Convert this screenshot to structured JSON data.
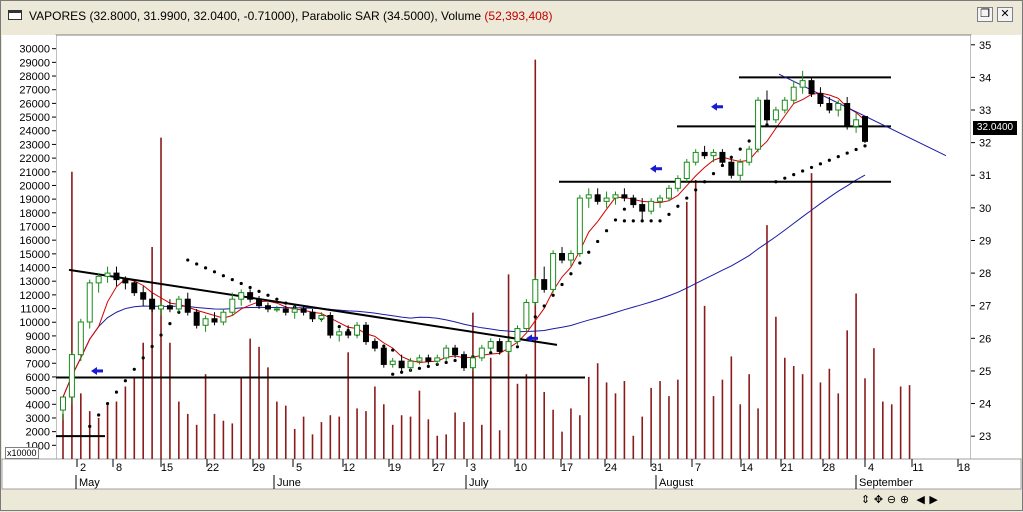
{
  "window": {
    "title_main": "VAPORES (32.8000, 31.9900, 32.0400, -0.71000), Parabolic SAR (34.5000), Volume",
    "title_volume": "(52,393,408)",
    "restore_icon": "restore-icon",
    "close_icon": "close-icon"
  },
  "chart_data": {
    "type": "candlestick",
    "title": "VAPORES",
    "ohlc_summary": {
      "open": 32.8,
      "high": 31.99,
      "low": 32.04,
      "change": -0.71
    },
    "parabolic_sar_last": 34.5,
    "volume_last": "52,393,408",
    "last_price_label": "32.0400",
    "price_axis": {
      "range": [
        22.3,
        35.3
      ],
      "ticks": [
        23,
        24,
        25,
        26,
        27,
        28,
        29,
        30,
        31,
        32,
        33,
        34,
        35
      ]
    },
    "volume_axis": {
      "unit_label": "x10000",
      "range": [
        0,
        31000
      ],
      "ticks": [
        1000,
        2000,
        3000,
        4000,
        5000,
        6000,
        7000,
        8000,
        9000,
        10000,
        11000,
        12000,
        13000,
        14000,
        15000,
        16000,
        17000,
        18000,
        19000,
        20000,
        21000,
        22000,
        23000,
        24000,
        25000,
        26000,
        27000,
        28000,
        29000,
        30000
      ]
    },
    "x_day_labels": [
      "2",
      "8",
      "15",
      "22",
      "29",
      "5",
      "12",
      "19",
      "27",
      "3",
      "10",
      "17",
      "24",
      "31",
      "7",
      "14",
      "21",
      "28",
      "4",
      "11",
      "18"
    ],
    "x_month_labels": [
      "May",
      "June",
      "July",
      "August",
      "September"
    ],
    "candles": [
      {
        "o": 23.8,
        "h": 24.1,
        "l": 23.5,
        "c": 24.2
      },
      {
        "o": 24.2,
        "h": 25.6,
        "l": 24.0,
        "c": 25.5
      },
      {
        "o": 25.5,
        "h": 26.6,
        "l": 25.3,
        "c": 26.5
      },
      {
        "o": 26.5,
        "h": 27.8,
        "l": 26.3,
        "c": 27.7
      },
      {
        "o": 27.7,
        "h": 28.0,
        "l": 27.4,
        "c": 27.9
      },
      {
        "o": 27.9,
        "h": 28.2,
        "l": 27.7,
        "c": 28.0
      },
      {
        "o": 28.0,
        "h": 28.2,
        "l": 27.6,
        "c": 27.8
      },
      {
        "o": 27.8,
        "h": 27.9,
        "l": 27.5,
        "c": 27.7
      },
      {
        "o": 27.7,
        "h": 27.8,
        "l": 27.3,
        "c": 27.4
      },
      {
        "o": 27.4,
        "h": 27.6,
        "l": 27.0,
        "c": 27.2
      },
      {
        "o": 27.2,
        "h": 27.4,
        "l": 26.8,
        "c": 26.9
      },
      {
        "o": 26.9,
        "h": 27.1,
        "l": 26.7,
        "c": 27.0
      },
      {
        "o": 27.0,
        "h": 27.2,
        "l": 26.8,
        "c": 26.9
      },
      {
        "o": 26.9,
        "h": 27.3,
        "l": 26.8,
        "c": 27.2
      },
      {
        "o": 27.2,
        "h": 27.4,
        "l": 26.7,
        "c": 26.8
      },
      {
        "o": 26.8,
        "h": 26.9,
        "l": 26.3,
        "c": 26.4
      },
      {
        "o": 26.4,
        "h": 26.7,
        "l": 26.2,
        "c": 26.6
      },
      {
        "o": 26.6,
        "h": 26.8,
        "l": 26.4,
        "c": 26.5
      },
      {
        "o": 26.5,
        "h": 26.9,
        "l": 26.4,
        "c": 26.8
      },
      {
        "o": 26.8,
        "h": 27.4,
        "l": 26.7,
        "c": 27.2
      },
      {
        "o": 27.2,
        "h": 27.5,
        "l": 27.0,
        "c": 27.4
      },
      {
        "o": 27.4,
        "h": 27.5,
        "l": 27.1,
        "c": 27.2
      },
      {
        "o": 27.2,
        "h": 27.3,
        "l": 26.9,
        "c": 27.0
      },
      {
        "o": 27.0,
        "h": 27.1,
        "l": 26.8,
        "c": 26.9
      },
      {
        "o": 26.9,
        "h": 27.0,
        "l": 26.8,
        "c": 26.9
      },
      {
        "o": 26.9,
        "h": 27.0,
        "l": 26.7,
        "c": 26.8
      },
      {
        "o": 26.8,
        "h": 27.0,
        "l": 26.6,
        "c": 26.9
      },
      {
        "o": 26.9,
        "h": 27.0,
        "l": 26.7,
        "c": 26.8
      },
      {
        "o": 26.8,
        "h": 26.9,
        "l": 26.5,
        "c": 26.6
      },
      {
        "o": 26.6,
        "h": 26.8,
        "l": 26.5,
        "c": 26.7
      },
      {
        "o": 26.7,
        "h": 26.8,
        "l": 26.0,
        "c": 26.1
      },
      {
        "o": 26.1,
        "h": 26.3,
        "l": 25.9,
        "c": 26.2
      },
      {
        "o": 26.2,
        "h": 26.4,
        "l": 26.0,
        "c": 26.1
      },
      {
        "o": 26.1,
        "h": 26.5,
        "l": 26.0,
        "c": 26.4
      },
      {
        "o": 26.4,
        "h": 26.5,
        "l": 25.8,
        "c": 25.9
      },
      {
        "o": 25.9,
        "h": 26.0,
        "l": 25.6,
        "c": 25.7
      },
      {
        "o": 25.7,
        "h": 25.8,
        "l": 25.1,
        "c": 25.2
      },
      {
        "o": 25.2,
        "h": 25.4,
        "l": 25.1,
        "c": 25.3
      },
      {
        "o": 25.3,
        "h": 25.5,
        "l": 25.0,
        "c": 25.1
      },
      {
        "o": 25.1,
        "h": 25.4,
        "l": 25.0,
        "c": 25.3
      },
      {
        "o": 25.3,
        "h": 25.5,
        "l": 25.2,
        "c": 25.4
      },
      {
        "o": 25.4,
        "h": 25.5,
        "l": 25.2,
        "c": 25.3
      },
      {
        "o": 25.3,
        "h": 25.5,
        "l": 25.2,
        "c": 25.4
      },
      {
        "o": 25.4,
        "h": 25.8,
        "l": 25.3,
        "c": 25.7
      },
      {
        "o": 25.7,
        "h": 25.8,
        "l": 25.4,
        "c": 25.5
      },
      {
        "o": 25.5,
        "h": 25.6,
        "l": 25.0,
        "c": 25.1
      },
      {
        "o": 25.1,
        "h": 25.5,
        "l": 25.0,
        "c": 25.4
      },
      {
        "o": 25.4,
        "h": 25.8,
        "l": 25.3,
        "c": 25.7
      },
      {
        "o": 25.7,
        "h": 26.0,
        "l": 25.6,
        "c": 25.9
      },
      {
        "o": 25.9,
        "h": 26.0,
        "l": 25.5,
        "c": 25.6
      },
      {
        "o": 25.6,
        "h": 26.0,
        "l": 25.5,
        "c": 25.9
      },
      {
        "o": 25.9,
        "h": 26.4,
        "l": 25.8,
        "c": 26.3
      },
      {
        "o": 26.3,
        "h": 27.2,
        "l": 26.2,
        "c": 27.1
      },
      {
        "o": 27.1,
        "h": 27.9,
        "l": 27.0,
        "c": 27.8
      },
      {
        "o": 27.8,
        "h": 28.2,
        "l": 27.4,
        "c": 27.5
      },
      {
        "o": 27.5,
        "h": 28.7,
        "l": 27.4,
        "c": 28.6
      },
      {
        "o": 28.6,
        "h": 28.8,
        "l": 28.3,
        "c": 28.4
      },
      {
        "o": 28.4,
        "h": 28.7,
        "l": 28.2,
        "c": 28.6
      },
      {
        "o": 28.6,
        "h": 30.4,
        "l": 28.5,
        "c": 30.3
      },
      {
        "o": 30.3,
        "h": 30.6,
        "l": 30.0,
        "c": 30.4
      },
      {
        "o": 30.4,
        "h": 30.6,
        "l": 30.1,
        "c": 30.2
      },
      {
        "o": 30.2,
        "h": 30.5,
        "l": 30.0,
        "c": 30.3
      },
      {
        "o": 30.3,
        "h": 30.5,
        "l": 30.1,
        "c": 30.4
      },
      {
        "o": 30.4,
        "h": 30.6,
        "l": 30.2,
        "c": 30.3
      },
      {
        "o": 30.3,
        "h": 30.4,
        "l": 30.0,
        "c": 30.1
      },
      {
        "o": 30.1,
        "h": 30.3,
        "l": 29.6,
        "c": 29.9
      },
      {
        "o": 29.9,
        "h": 30.3,
        "l": 29.8,
        "c": 30.2
      },
      {
        "o": 30.2,
        "h": 30.4,
        "l": 30.0,
        "c": 30.3
      },
      {
        "o": 30.3,
        "h": 30.7,
        "l": 30.2,
        "c": 30.6
      },
      {
        "o": 30.6,
        "h": 31.0,
        "l": 30.5,
        "c": 30.9
      },
      {
        "o": 30.9,
        "h": 31.5,
        "l": 30.8,
        "c": 31.4
      },
      {
        "o": 31.4,
        "h": 31.8,
        "l": 31.3,
        "c": 31.7
      },
      {
        "o": 31.7,
        "h": 31.9,
        "l": 31.5,
        "c": 31.6
      },
      {
        "o": 31.6,
        "h": 31.8,
        "l": 31.4,
        "c": 31.7
      },
      {
        "o": 31.7,
        "h": 31.8,
        "l": 31.3,
        "c": 31.4
      },
      {
        "o": 31.4,
        "h": 31.6,
        "l": 30.9,
        "c": 31.0
      },
      {
        "o": 31.0,
        "h": 31.5,
        "l": 30.8,
        "c": 31.4
      },
      {
        "o": 31.4,
        "h": 31.9,
        "l": 31.3,
        "c": 31.8
      },
      {
        "o": 31.8,
        "h": 33.4,
        "l": 31.7,
        "c": 33.3
      },
      {
        "o": 33.3,
        "h": 33.6,
        "l": 32.6,
        "c": 32.7
      },
      {
        "o": 32.7,
        "h": 33.1,
        "l": 32.6,
        "c": 33.0
      },
      {
        "o": 33.0,
        "h": 33.4,
        "l": 32.9,
        "c": 33.3
      },
      {
        "o": 33.3,
        "h": 33.9,
        "l": 33.2,
        "c": 33.7
      },
      {
        "o": 33.7,
        "h": 34.2,
        "l": 33.5,
        "c": 33.9
      },
      {
        "o": 33.9,
        "h": 34.0,
        "l": 33.4,
        "c": 33.5
      },
      {
        "o": 33.5,
        "h": 33.7,
        "l": 33.1,
        "c": 33.2
      },
      {
        "o": 33.2,
        "h": 33.4,
        "l": 32.9,
        "c": 33.0
      },
      {
        "o": 33.0,
        "h": 33.3,
        "l": 32.8,
        "c": 33.2
      },
      {
        "o": 33.2,
        "h": 33.4,
        "l": 32.4,
        "c": 32.5
      },
      {
        "o": 32.5,
        "h": 32.9,
        "l": 32.3,
        "c": 32.7
      },
      {
        "o": 32.8,
        "h": 32.8,
        "l": 31.99,
        "c": 32.04
      }
    ],
    "volume": [
      3300,
      21000,
      4800,
      3500,
      3000,
      4000,
      4200,
      5300,
      6000,
      8500,
      15500,
      23500,
      8500,
      4200,
      3300,
      2500,
      6200,
      3300,
      2800,
      2600,
      6000,
      8800,
      8200,
      6700,
      4200,
      3900,
      2200,
      3100,
      1800,
      2700,
      3200,
      3100,
      7800,
      3700,
      3500,
      5300,
      4000,
      2500,
      3200,
      3100,
      5000,
      2900,
      1700,
      1800,
      3400,
      2700,
      10700,
      2500,
      7400,
      2100,
      13500,
      5500,
      6200,
      29200,
      4900,
      3600,
      2000,
      3700,
      3200,
      6000,
      7000,
      5600,
      4800,
      5700,
      1700,
      3100,
      5200,
      5700,
      4600,
      5800,
      18800,
      20400,
      11200,
      4600,
      5800,
      7500,
      4000,
      6200,
      3700,
      17100,
      10400,
      7400,
      6800,
      6200,
      20900,
      5600,
      6600,
      4800,
      9400,
      12100,
      5900,
      8100,
      4200,
      4000,
      5300,
      5400
    ],
    "overlays": [
      {
        "name": "Parabolic SAR",
        "color": "#000000"
      },
      {
        "name": "Moving average (short)",
        "color": "#d40000"
      },
      {
        "name": "Moving average (long)",
        "color": "#1a1aa8"
      }
    ]
  },
  "navigation": {
    "icons": [
      "nav-up-down-icon",
      "nav-move-icon",
      "zoom-out-icon",
      "zoom-in-icon",
      "scroll-left-icon",
      "scroll-right-icon"
    ],
    "labels": [
      "⇕",
      "✥",
      "⊖",
      "⊕",
      "◀",
      "▶"
    ]
  }
}
